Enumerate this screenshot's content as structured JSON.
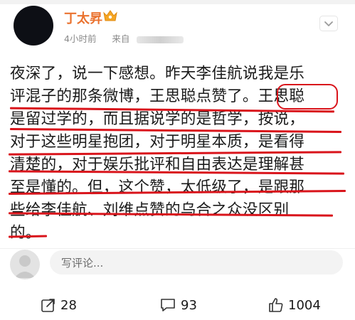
{
  "post": {
    "username": "丁太昇",
    "time": "4小时前",
    "source_prefix": "来自",
    "lines": [
      "夜深了，说一下感想。昨天李佳航说我是乐",
      "评混子的那条微博，王思聪点赞了。王思聪",
      "是留过学的，而且据说学的是哲学，按说，",
      "对于这些明星抱团，对于明星本质，是看得",
      "清楚的，对于娱乐批评和自由表达是理解甚",
      "至是懂的。但，这个赞，太低级了，是跟那",
      "些给李佳航、刘维点赞的乌合之众没区别",
      "的。"
    ]
  },
  "comment": {
    "placeholder": "写评论..."
  },
  "actions": {
    "repost_count": "28",
    "comment_count": "93",
    "like_count": "1004"
  },
  "colors": {
    "username": "#ea7330",
    "annotation": "#d9141b",
    "meta": "#8a8a8a"
  }
}
